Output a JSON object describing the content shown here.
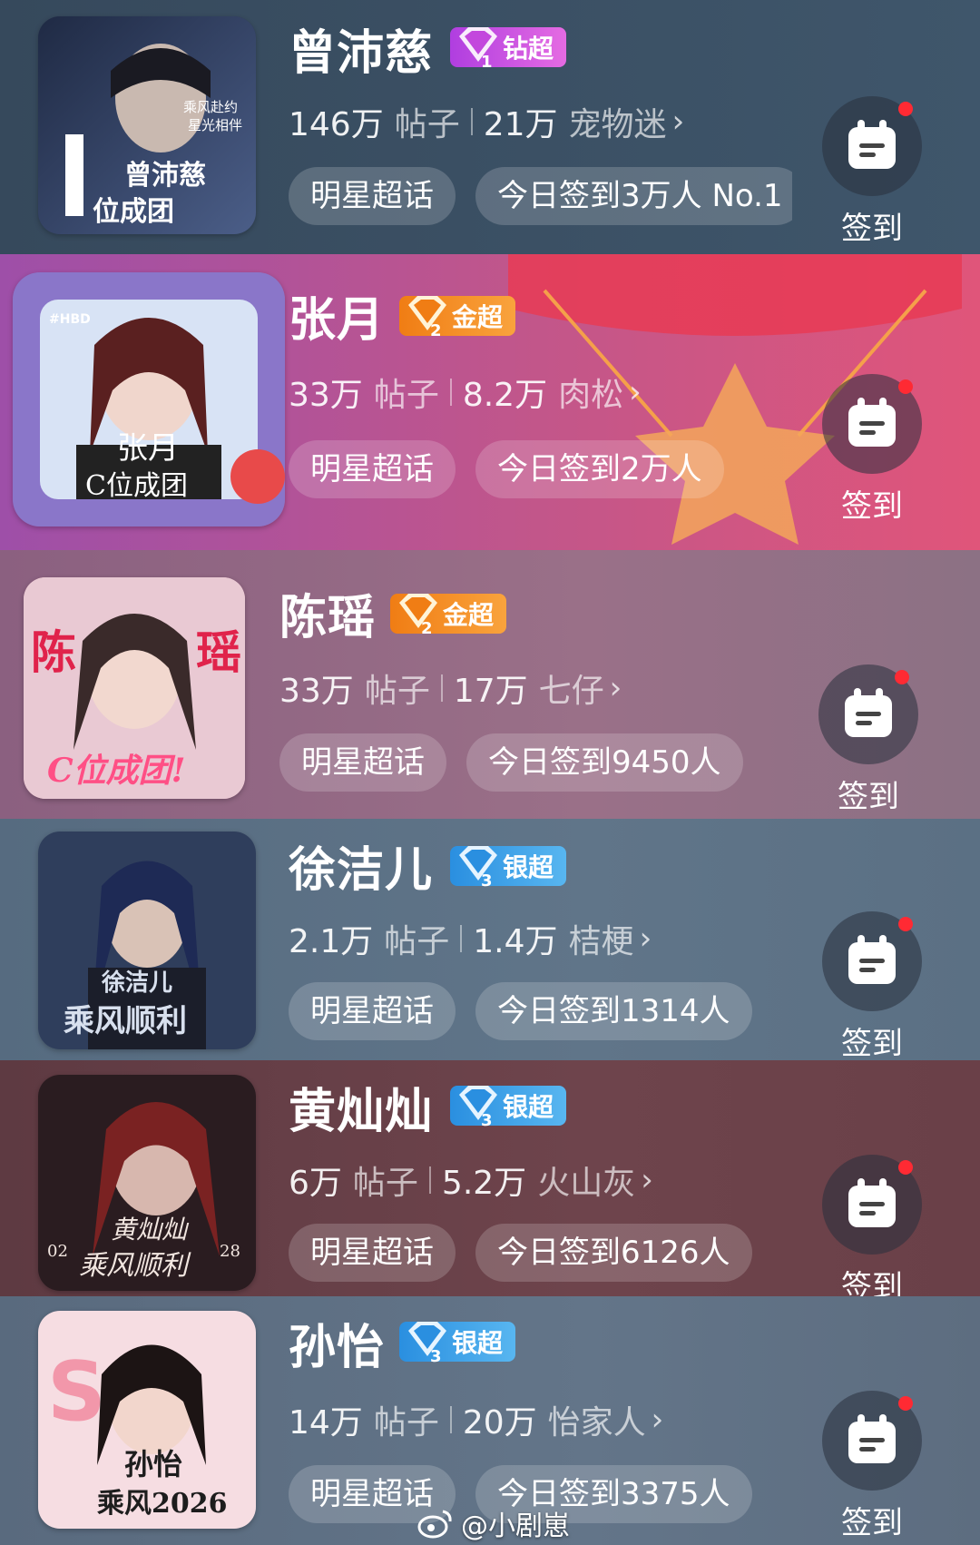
{
  "checkin_label": "签到",
  "chip_common": "明星超话",
  "items": [
    {
      "name": "曾沛慈",
      "badge": "钻超",
      "badge_level": "1",
      "posts": "146万",
      "posts_unit": "帖子",
      "fans": "21万",
      "fans_name": "宠物迷",
      "checkin_chip": "今日签到3万人 No.1",
      "cover_text": [
        "曾沛慈",
        "位成团",
        "乘风赴约",
        "星光相伴"
      ],
      "bg": "#3b5064"
    },
    {
      "name": "张月",
      "badge": "金超",
      "badge_level": "2",
      "posts": "33万",
      "posts_unit": "帖子",
      "fans": "8.2万",
      "fans_name": "肉松",
      "checkin_chip": "今日签到2万人",
      "cover_text": [
        "张月",
        "C位成团",
        "#HBD"
      ],
      "bg": "#b0527a"
    },
    {
      "name": "陈瑶",
      "badge": "金超",
      "badge_level": "2",
      "posts": "33万",
      "posts_unit": "帖子",
      "fans": "17万",
      "fans_name": "七仔",
      "checkin_chip": "今日签到9450人",
      "cover_text": [
        "陈",
        "瑶",
        "C位成团!"
      ],
      "bg": "#8c6a84"
    },
    {
      "name": "徐洁儿",
      "badge": "银超",
      "badge_level": "3",
      "posts": "2.1万",
      "posts_unit": "帖子",
      "fans": "1.4万",
      "fans_name": "桔梗",
      "checkin_chip": "今日签到1314人",
      "cover_text": [
        "徐洁儿",
        "乘风顺利"
      ],
      "bg": "#5b7084"
    },
    {
      "name": "黄灿灿",
      "badge": "银超",
      "badge_level": "3",
      "posts": "6万",
      "posts_unit": "帖子",
      "fans": "5.2万",
      "fans_name": "火山灰",
      "checkin_chip": "今日签到6126人",
      "cover_text": [
        "黄灿灿",
        "乘风顺利",
        "02",
        "28"
      ],
      "bg": "#6a4048"
    },
    {
      "name": "孙怡",
      "badge": "银超",
      "badge_level": "3",
      "posts": "14万",
      "posts_unit": "帖子",
      "fans": "20万",
      "fans_name": "怡家人",
      "checkin_chip": "今日签到3375人",
      "cover_text": [
        "孙怡",
        "乘风2026"
      ],
      "bg": "#5d6d80"
    }
  ],
  "badge_colors": {
    "钻超": "#d94fd6",
    "金超": "#f28a1e",
    "银超": "#3ba3e8"
  },
  "accent_red": "#ff2a33",
  "watermark": "@小剧崽"
}
